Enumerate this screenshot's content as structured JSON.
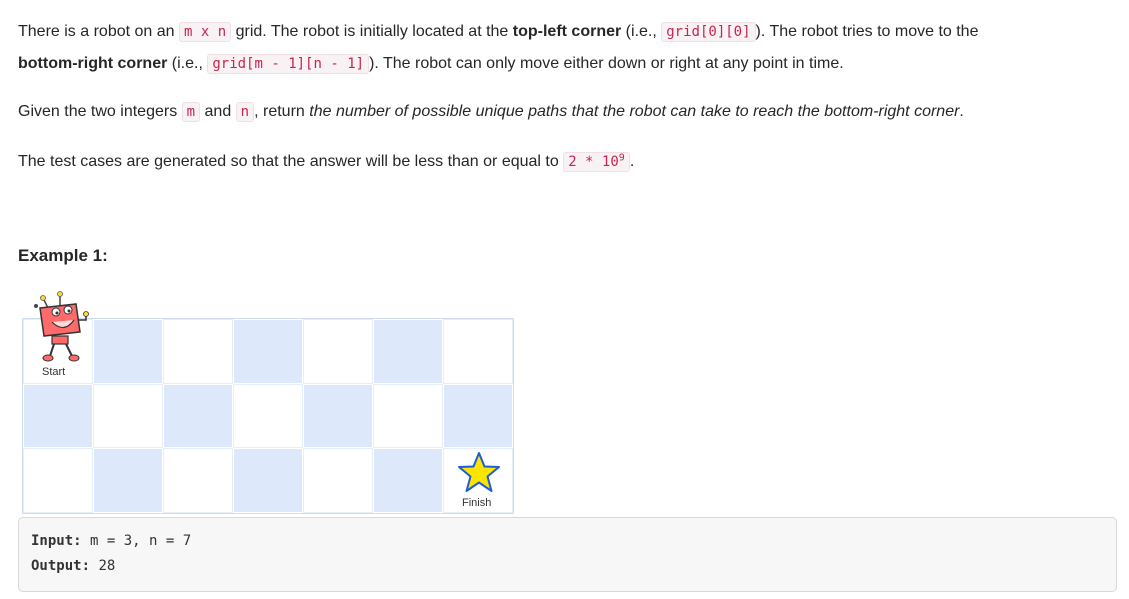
{
  "description": {
    "p1": {
      "t1": "There is a robot on an ",
      "c1": "m x n",
      "t2": " grid. The robot is initially located at the ",
      "b1": "top-left corner",
      "t3": " (i.e., ",
      "c2": "grid[0][0]",
      "t4": "). The robot tries to move to the ",
      "b2": "bottom-right corner",
      "t5": " (i.e., ",
      "c3": "grid[m - 1][n - 1]",
      "t6": "). The robot can only move either down or right at any point in time."
    },
    "p2": {
      "t1": "Given the two integers ",
      "c1": "m",
      "t2": " and ",
      "c2": "n",
      "t3": ", return ",
      "i1": "the number of possible unique paths that the robot can take to reach the bottom-right corner",
      "t4": "."
    },
    "p3": {
      "t1": "The test cases are generated so that the answer will be less than or equal to ",
      "c1": "2 * 10",
      "sup": "9",
      "t2": "."
    }
  },
  "example": {
    "title": "Example 1:",
    "image": {
      "rows": 3,
      "cols": 7,
      "start_label": "Start",
      "finish_label": "Finish",
      "robot_icon": "robot-icon",
      "finish_icon": "star-icon",
      "colors": {
        "blue_cell": "#dde9fb",
        "star": "#ffe400",
        "robot": "#ff6b6b"
      }
    },
    "input_label": "Input:",
    "input_value": " m = 3, n = 7",
    "output_label": "Output:",
    "output_value": " 28"
  }
}
